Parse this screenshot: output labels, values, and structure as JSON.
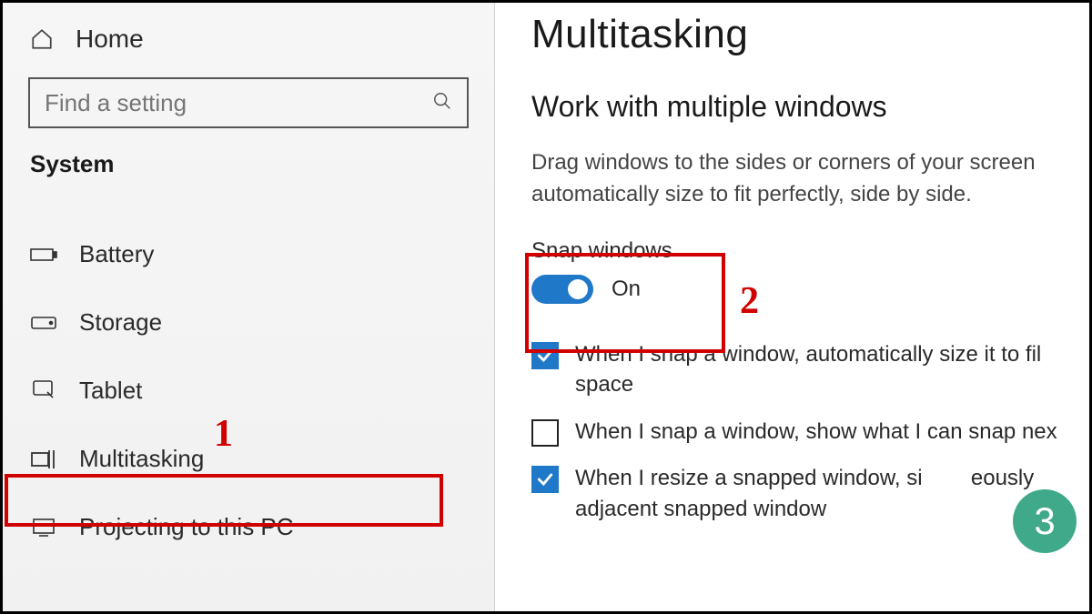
{
  "sidebar": {
    "home_label": "Home",
    "search_placeholder": "Find a setting",
    "category_label": "System",
    "items": [
      {
        "icon": "battery",
        "label": "Battery"
      },
      {
        "icon": "storage",
        "label": "Storage"
      },
      {
        "icon": "tablet",
        "label": "Tablet"
      },
      {
        "icon": "multitasking",
        "label": "Multitasking"
      },
      {
        "icon": "projecting",
        "label": "Projecting to this PC"
      }
    ]
  },
  "main": {
    "title": "Multitasking",
    "section_heading": "Work with multiple windows",
    "section_desc": "Drag windows to the sides or corners of your screen automatically size to fit perfectly, side by side.",
    "snap": {
      "label": "Snap windows",
      "state": "On",
      "on": true
    },
    "checkboxes": [
      {
        "checked": true,
        "label": "When I snap a window, automatically size it to fil space"
      },
      {
        "checked": false,
        "label": "When I snap a window, show what I can snap nex"
      },
      {
        "checked": true,
        "label": "When I resize a snapped window, si        eously adjacent snapped window"
      }
    ]
  },
  "annotations": {
    "num1": "1",
    "num2": "2",
    "badge3": "3"
  }
}
